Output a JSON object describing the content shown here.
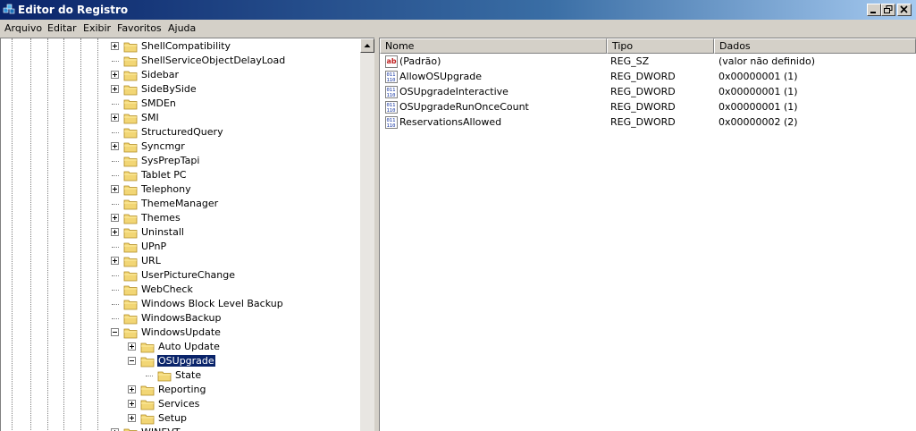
{
  "window": {
    "title": "Editor do Registro",
    "controls": [
      "minimize",
      "restore",
      "close"
    ]
  },
  "menu": [
    "Arquivo",
    "Editar",
    "Exibir",
    "Favoritos",
    "Ajuda"
  ],
  "tree": {
    "nodes": [
      {
        "label": "ShellCompatibility",
        "expandable": true
      },
      {
        "label": "ShellServiceObjectDelayLoad",
        "expandable": false
      },
      {
        "label": "Sidebar",
        "expandable": true
      },
      {
        "label": "SideBySide",
        "expandable": true
      },
      {
        "label": "SMDEn",
        "expandable": false
      },
      {
        "label": "SMI",
        "expandable": true
      },
      {
        "label": "StructuredQuery",
        "expandable": false
      },
      {
        "label": "Syncmgr",
        "expandable": true
      },
      {
        "label": "SysPrepTapi",
        "expandable": false
      },
      {
        "label": "Tablet PC",
        "expandable": false
      },
      {
        "label": "Telephony",
        "expandable": true
      },
      {
        "label": "ThemeManager",
        "expandable": false
      },
      {
        "label": "Themes",
        "expandable": true
      },
      {
        "label": "Uninstall",
        "expandable": true
      },
      {
        "label": "UPnP",
        "expandable": false
      },
      {
        "label": "URL",
        "expandable": true
      },
      {
        "label": "UserPictureChange",
        "expandable": false
      },
      {
        "label": "WebCheck",
        "expandable": false
      },
      {
        "label": "Windows Block Level Backup",
        "expandable": false
      },
      {
        "label": "WindowsBackup",
        "expandable": false
      },
      {
        "label": "WindowsUpdate",
        "expandable": true,
        "expanded": true
      },
      {
        "label": "Auto Update",
        "expandable": true,
        "depth": 1
      },
      {
        "label": "OSUpgrade",
        "expandable": true,
        "expanded": true,
        "depth": 1,
        "selected": true
      },
      {
        "label": "State",
        "expandable": false,
        "depth": 2
      },
      {
        "label": "Reporting",
        "expandable": true,
        "depth": 1
      },
      {
        "label": "Services",
        "expandable": true,
        "depth": 1
      },
      {
        "label": "Setup",
        "expandable": true,
        "depth": 1
      },
      {
        "label": "WINEVT",
        "expandable": true
      }
    ]
  },
  "list": {
    "columns": [
      "Nome",
      "Tipo",
      "Dados"
    ],
    "rows": [
      {
        "icon": "string-value-icon",
        "name": "(Padrão)",
        "type": "REG_SZ",
        "data": "(valor não definido)"
      },
      {
        "icon": "dword-value-icon",
        "name": "AllowOSUpgrade",
        "type": "REG_DWORD",
        "data": "0x00000001 (1)"
      },
      {
        "icon": "dword-value-icon",
        "name": "OSUpgradeInteractive",
        "type": "REG_DWORD",
        "data": "0x00000001 (1)"
      },
      {
        "icon": "dword-value-icon",
        "name": "OSUpgradeRunOnceCount",
        "type": "REG_DWORD",
        "data": "0x00000001 (1)"
      },
      {
        "icon": "dword-value-icon",
        "name": "ReservationsAllowed",
        "type": "REG_DWORD",
        "data": "0x00000002 (2)"
      }
    ]
  }
}
